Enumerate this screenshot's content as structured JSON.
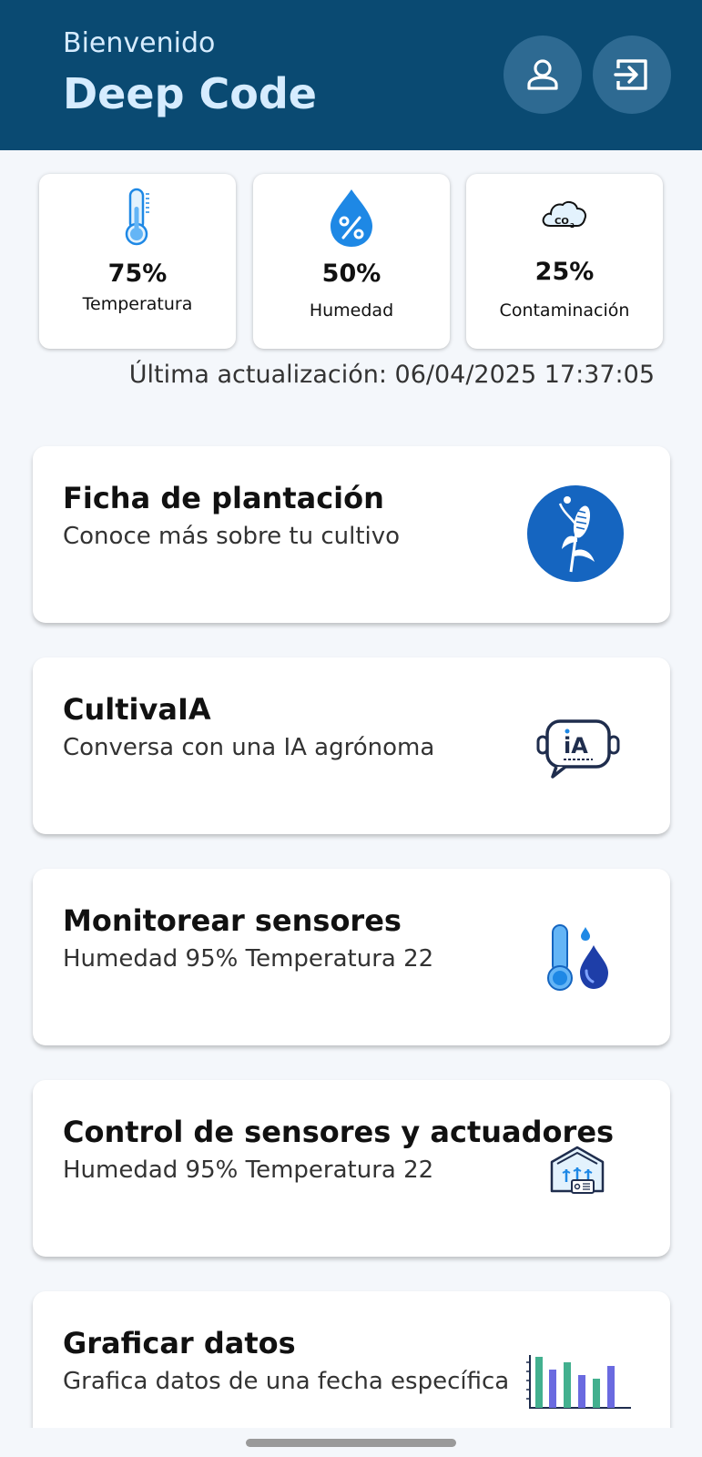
{
  "header": {
    "greeting": "Bienvenido",
    "username": "Deep Code",
    "profile_icon": "person-icon",
    "logout_icon": "logout-icon"
  },
  "stats": [
    {
      "icon": "thermometer-icon",
      "value": "75%",
      "label": "Temperatura"
    },
    {
      "icon": "humidity-drop-icon",
      "value": "50%",
      "label": "Humedad"
    },
    {
      "icon": "co2-cloud-icon",
      "value": "25%",
      "label": "Contaminación"
    }
  ],
  "last_update": "Última actualización: 06/04/2025 17:37:05",
  "cards": [
    {
      "title": "Ficha de plantación",
      "subtitle": "Conoce más sobre tu cultivo",
      "icon": "corn-plant-icon"
    },
    {
      "title": "CultivaIA",
      "subtitle": "Conversa con una IA agrónoma",
      "icon": "ai-chat-icon"
    },
    {
      "title": "Monitorear sensores",
      "subtitle": "Humedad 95% Temperatura 22",
      "icon": "thermometer-drop-icon"
    },
    {
      "title": "Control de sensores y actuadores",
      "subtitle": "Humedad 95% Temperatura 22",
      "icon": "greenhouse-icon"
    },
    {
      "title": "Graficar datos",
      "subtitle": "Grafica datos de una fecha específica",
      "icon": "bar-chart-icon"
    }
  ],
  "colors": {
    "header_bg": "#0a4a72",
    "header_text": "#d6ecff",
    "accent_blue": "#1565c0",
    "bg": "#f4f7fb"
  }
}
